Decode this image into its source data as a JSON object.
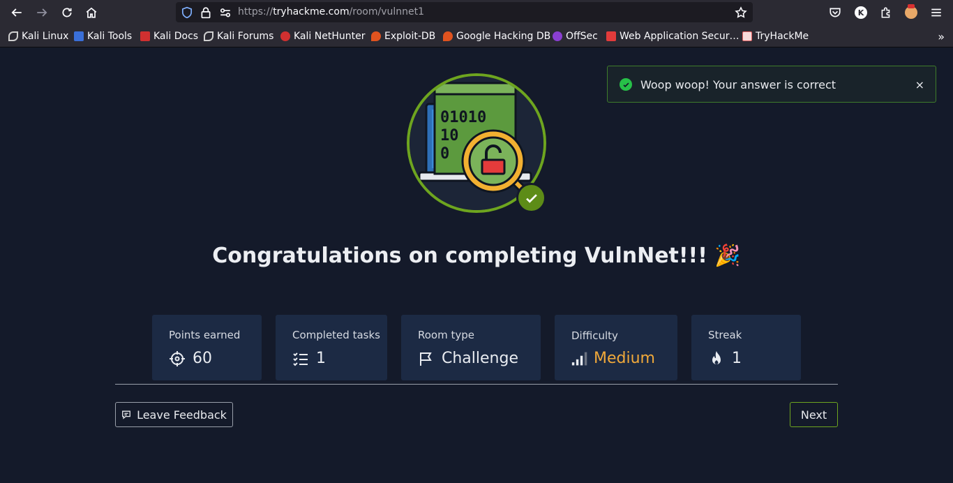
{
  "browser": {
    "url_prefix": "https://",
    "url_host": "tryhackme.com",
    "url_path": "/room/vulnnet1",
    "bookmarks": [
      {
        "label": "Kali Linux",
        "color": "#cccccc"
      },
      {
        "label": "Kali Tools",
        "color": "#3a6fd8"
      },
      {
        "label": "Kali Docs",
        "color": "#d03030"
      },
      {
        "label": "Kali Forums",
        "color": "#cccccc"
      },
      {
        "label": "Kali NetHunter",
        "color": "#d03030"
      },
      {
        "label": "Exploit-DB",
        "color": "#e0531f"
      },
      {
        "label": "Google Hacking DB",
        "color": "#e0531f"
      },
      {
        "label": "OffSec",
        "color": "#8a3fd1"
      },
      {
        "label": "Web Application Secur…",
        "color": "#e23b3b"
      },
      {
        "label": "TryHackMe",
        "color": "#e06060"
      }
    ]
  },
  "page": {
    "title": "Congratulations on completing VulnNet!!! 🎉",
    "stats": [
      {
        "label": "Points earned",
        "value": "60",
        "icon": "target-icon"
      },
      {
        "label": "Completed tasks",
        "value": "1",
        "icon": "task-list-icon"
      },
      {
        "label": "Room type",
        "value": "Challenge",
        "icon": "flag-icon"
      },
      {
        "label": "Difficulty",
        "value": "Medium",
        "icon": "signal-bars-icon"
      },
      {
        "label": "Streak",
        "value": "1",
        "icon": "flame-icon"
      }
    ],
    "feedback_label": "Leave Feedback",
    "next_label": "Next"
  },
  "toast": {
    "message": "Woop woop! Your answer is correct",
    "close": "×"
  },
  "colors": {
    "background": "#141a2a",
    "card": "#1c2a44",
    "accent_green": "#6ea51f",
    "difficulty_medium": "#f1a93a"
  }
}
